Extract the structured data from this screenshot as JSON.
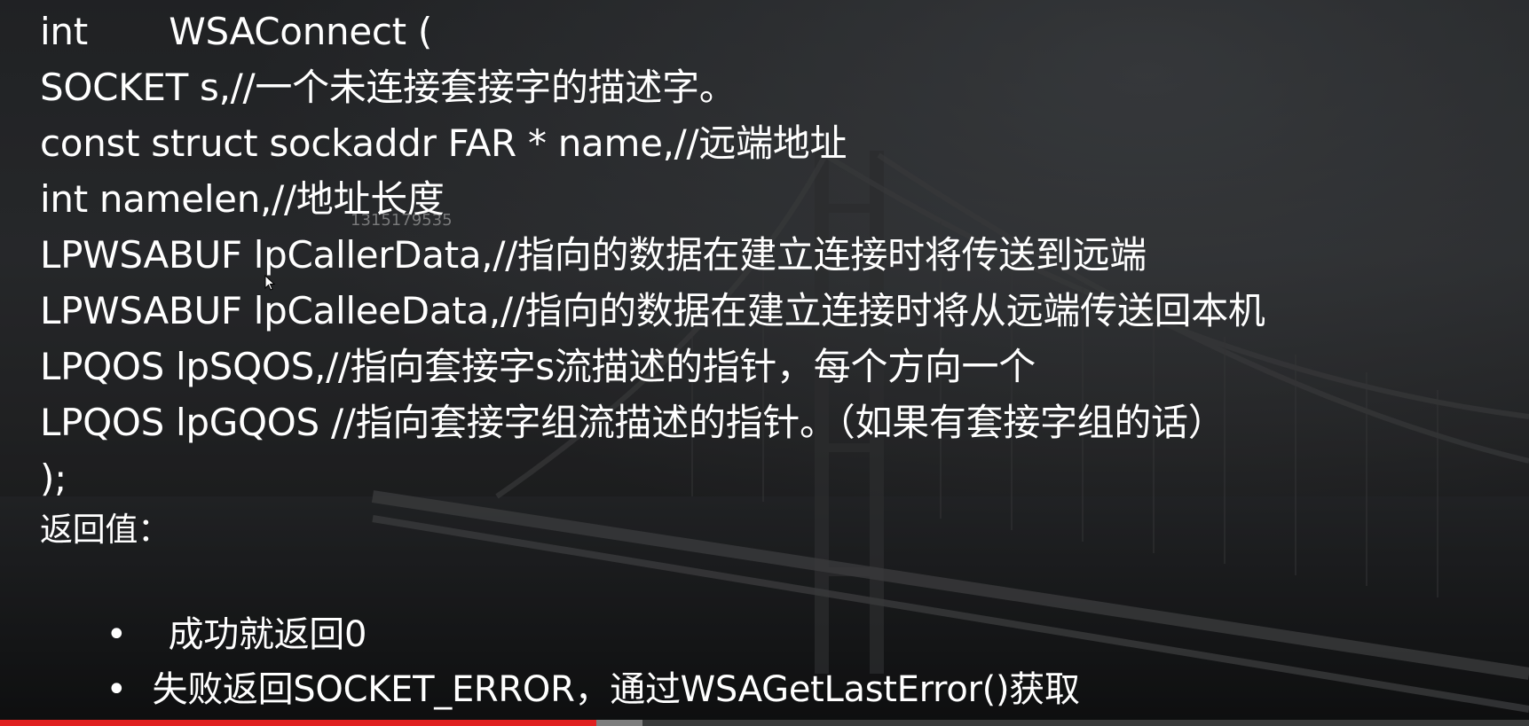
{
  "slide": {
    "lines": [
      "int       WSAConnect (",
      "SOCKET s,//一个未连接套接字的描述字。",
      "const struct sockaddr FAR * name,//远端地址",
      "int namelen,//地址长度",
      "LPWSABUF lpCallerData,//指向的数据在建立连接时将传送到远端",
      "LPWSABUF lpCalleeData,//指向的数据在建立连接时将从远端传送回本机",
      "LPQOS lpSQOS,//指向套接字s流描述的指针，每个方向一个",
      "LPQOS lpGQOS //指向套接字组流描述的指针。（如果有套接字组的话）",
      ");"
    ],
    "return_label": "返回值：",
    "bullets": [
      {
        "marker": "•",
        "text": "成功就返回0"
      },
      {
        "marker": "•",
        "text": "失败返回SOCKET_ERROR，通过WSAGetLastError()获取"
      }
    ],
    "watermark": "1315179535"
  },
  "player": {
    "played_fraction": 0.39,
    "buffered_fraction": 0.42,
    "played_color": "#e02020"
  },
  "colors": {
    "text": "#ffffff",
    "background": "#2b2d30"
  }
}
